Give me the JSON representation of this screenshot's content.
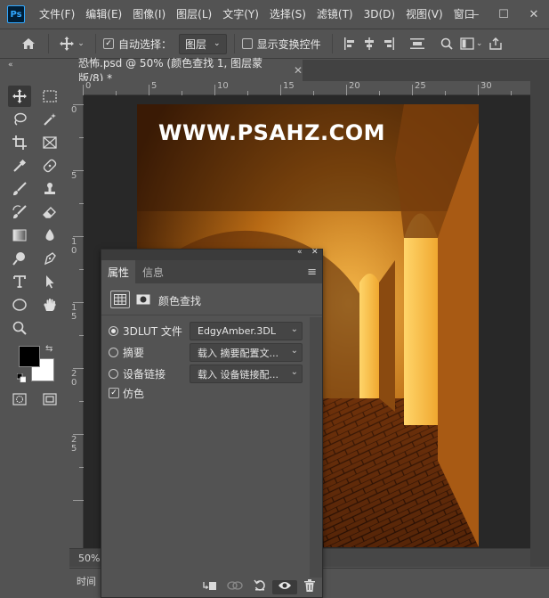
{
  "app": {
    "logo": "Ps"
  },
  "menu": [
    "文件(F)",
    "编辑(E)",
    "图像(I)",
    "图层(L)",
    "文字(Y)",
    "选择(S)",
    "滤镜(T)",
    "3D(D)",
    "视图(V)",
    "窗口"
  ],
  "window_controls": [
    "—",
    "☐",
    "✕"
  ],
  "options": {
    "auto_select_label": "自动选择：",
    "auto_select_checked": true,
    "layer_dropdown": "图层",
    "show_transform_label": "显示变换控件",
    "show_transform_checked": false
  },
  "tab": {
    "title": "恐怖.psd @ 50% (颜色查找 1, 图层蒙版/8) *",
    "close": "✕"
  },
  "toolbar": {
    "collapse": "«"
  },
  "rulers": {
    "h": [
      "0",
      "5",
      "10",
      "15",
      "20",
      "25",
      "30"
    ],
    "v": [
      "0",
      "5",
      "1 0",
      "1 5",
      "2 0",
      "2 5"
    ]
  },
  "canvas": {
    "watermark": "WWW.PSAHZ.COM"
  },
  "status": {
    "zoom": "50%"
  },
  "timeline": {
    "label": "时间"
  },
  "panel": {
    "top_icons": [
      "«",
      "✕"
    ],
    "tabs": [
      "属性",
      "信息"
    ],
    "menu_icon": "≡",
    "adjust_title": "颜色查找",
    "options": [
      {
        "label": "3DLUT 文件",
        "selected": true,
        "value": "EdgyAmber.3DL"
      },
      {
        "label": "摘要",
        "selected": false,
        "value": "载入 摘要配置文..."
      },
      {
        "label": "设备链接",
        "selected": false,
        "value": "载入 设备链接配..."
      }
    ],
    "dither_label": "仿色",
    "dither_checked": true,
    "footer_icons": [
      "clip-to-layer-icon",
      "view-previous-icon",
      "reset-icon",
      "visibility-icon",
      "trash-icon"
    ]
  }
}
